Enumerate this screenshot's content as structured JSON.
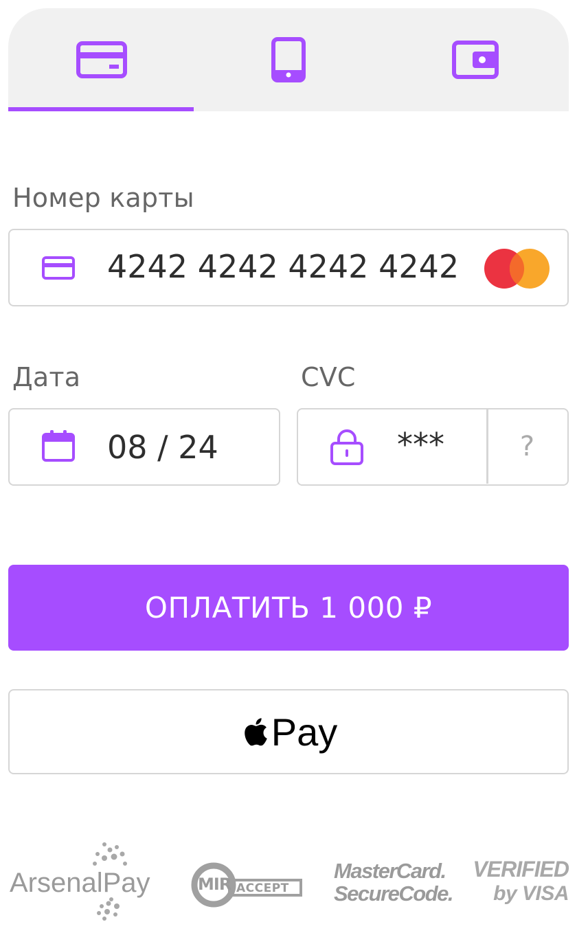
{
  "tabs": [
    {
      "name": "card",
      "icon": "credit-card-icon",
      "active": true
    },
    {
      "name": "mobile",
      "icon": "smartphone-icon",
      "active": false
    },
    {
      "name": "wallet",
      "icon": "wallet-icon",
      "active": false
    }
  ],
  "card_number": {
    "label": "Номер карты",
    "value": "4242 4242 4242 4242",
    "icon": "credit-card-icon",
    "brand_icon": "mastercard-icon"
  },
  "date": {
    "label": "Дата",
    "value": "08 / 24",
    "icon": "calendar-icon"
  },
  "cvc": {
    "label": "CVC",
    "value": "***",
    "icon": "lock-icon",
    "help": "?"
  },
  "pay_button": {
    "label": "ОПЛАТИТЬ 1 000 ₽"
  },
  "apple_pay": {
    "label": "Pay",
    "icon": "apple-icon"
  },
  "footer_logos": {
    "arsenalpay": "ArsenalPay",
    "mir_main": "MIR",
    "mir_accept": "ACCEPT",
    "mastercard_line1": "MasterCard.",
    "mastercard_line2": "SecureCode.",
    "visa_line1": "VERIFIED",
    "visa_line2": "by VISA"
  },
  "colors": {
    "accent": "#a64dff",
    "tab_bg": "#f1f1f1",
    "border": "#d6d6d6",
    "mastercard_red": "#eb3341",
    "mastercard_orange": "#f9a72b",
    "logo_gray": "#9a9a9a"
  }
}
